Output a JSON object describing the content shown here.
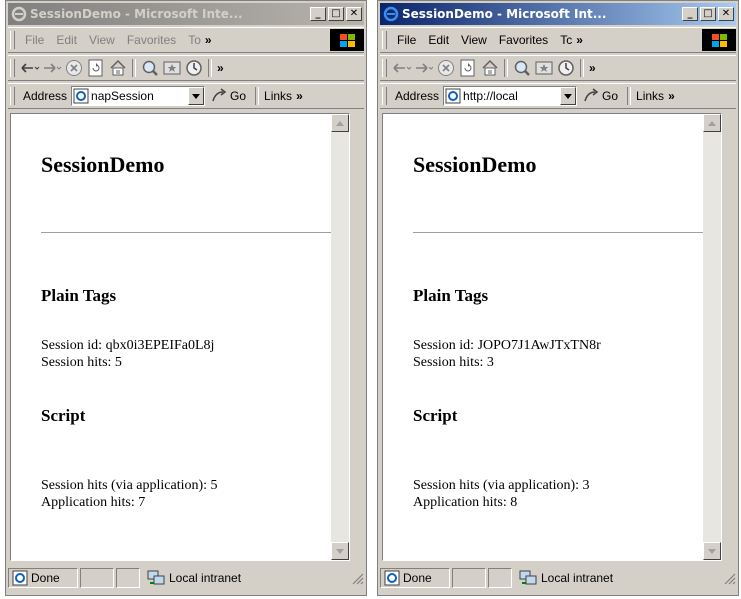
{
  "windows": [
    {
      "title": "SessionDemo - Microsoft Inte...",
      "menu": [
        "File",
        "Edit",
        "View",
        "Favorites",
        "To"
      ],
      "address_label": "Address",
      "address_value": "napSession",
      "go_label": "Go",
      "links_label": "Links",
      "page": {
        "heading": "SessionDemo",
        "section1": "Plain Tags",
        "session_id": "Session id: qbx0i3EPEIFa0L8j",
        "session_hits": "Session hits: 5",
        "section2": "Script",
        "session_hits_app": "Session hits (via application): 5",
        "application_hits": "Application hits: 7"
      },
      "status": "Done",
      "zone": "Local intranet"
    },
    {
      "title": "SessionDemo - Microsoft Int...",
      "menu": [
        "File",
        "Edit",
        "View",
        "Favorites",
        "Tc"
      ],
      "address_label": "Address",
      "address_value": "http://local",
      "go_label": "Go",
      "links_label": "Links",
      "page": {
        "heading": "SessionDemo",
        "section1": "Plain Tags",
        "session_id": "Session id: JOPO7J1AwJTxTN8r",
        "session_hits": "Session hits: 3",
        "section2": "Script",
        "session_hits_app": "Session hits (via application): 3",
        "application_hits": "Application hits: 8"
      },
      "status": "Done",
      "zone": "Local intranet"
    }
  ],
  "controls": {
    "minimize": "_",
    "maximize": "□",
    "close": "✕"
  },
  "chevron": "»"
}
